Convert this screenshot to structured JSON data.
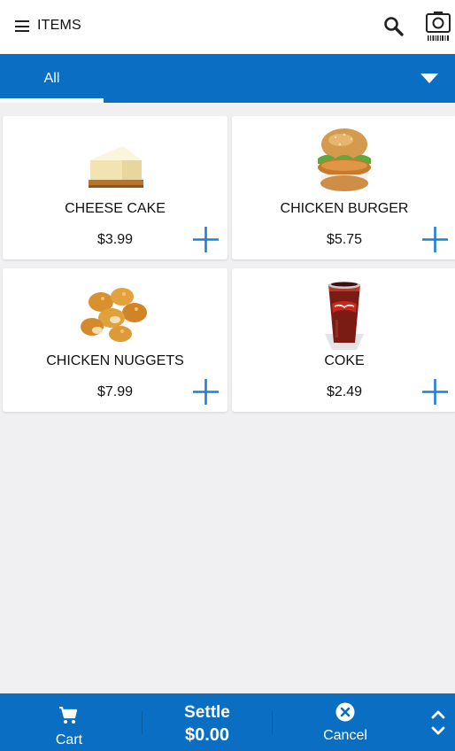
{
  "header": {
    "title": "ITEMS",
    "menu_icon": "hamburger-menu-icon",
    "search_icon": "search-icon",
    "scan_icon": "camera-barcode-icon"
  },
  "tabs": {
    "active_label": "All",
    "dropdown_icon": "triangle-down-icon"
  },
  "colors": {
    "primary": "#0a6fc2",
    "accent_plus": "#1e7fd6"
  },
  "items": [
    {
      "name": "CHEESE CAKE",
      "price": "$3.99",
      "image": "cheesecake-image"
    },
    {
      "name": "CHICKEN BURGER",
      "price": "$5.75",
      "image": "chicken-burger-image"
    },
    {
      "name": "CHICKEN NUGGETS",
      "price": "$7.99",
      "image": "chicken-nuggets-image"
    },
    {
      "name": "COKE",
      "price": "$2.49",
      "image": "coke-cup-image"
    }
  ],
  "footer": {
    "cart_label": "Cart",
    "settle_label": "Settle",
    "settle_total": "$0.00",
    "cancel_label": "Cancel"
  }
}
